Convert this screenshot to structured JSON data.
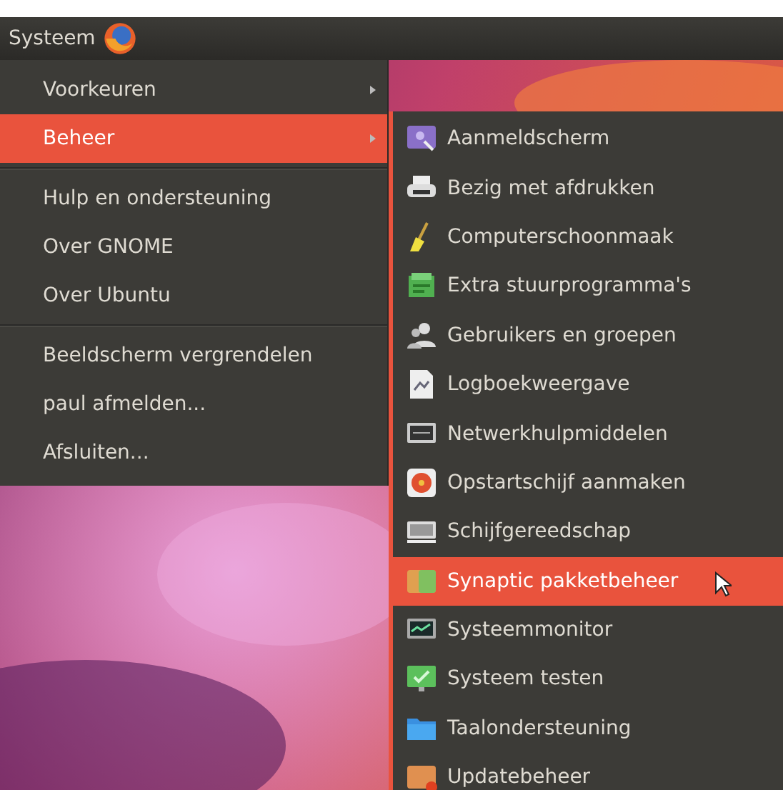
{
  "panel": {
    "menu_label": "Systeem"
  },
  "menu": {
    "sections": [
      {
        "items": [
          {
            "label": "Voorkeuren",
            "selected": false,
            "submenu": true
          },
          {
            "label": "Beheer",
            "selected": true,
            "submenu": true
          }
        ]
      },
      {
        "items": [
          {
            "label": "Hulp en ondersteuning",
            "selected": false,
            "submenu": false
          },
          {
            "label": "Over GNOME",
            "selected": false,
            "submenu": false
          },
          {
            "label": "Over Ubuntu",
            "selected": false,
            "submenu": false
          }
        ]
      },
      {
        "items": [
          {
            "label": "Beeldscherm vergrendelen",
            "selected": false,
            "submenu": false
          },
          {
            "label": "paul afmelden...",
            "selected": false,
            "submenu": false
          },
          {
            "label": "Afsluiten...",
            "selected": false,
            "submenu": false
          }
        ]
      }
    ]
  },
  "submenu": {
    "items": [
      {
        "label": "Aanmeldscherm",
        "selected": false
      },
      {
        "label": "Bezig met afdrukken",
        "selected": false
      },
      {
        "label": "Computerschoonmaak",
        "selected": false
      },
      {
        "label": "Extra stuurprogramma's",
        "selected": false
      },
      {
        "label": "Gebruikers en groepen",
        "selected": false
      },
      {
        "label": "Logboekweergave",
        "selected": false
      },
      {
        "label": "Netwerkhulpmiddelen",
        "selected": false
      },
      {
        "label": "Opstartschijf aanmaken",
        "selected": false
      },
      {
        "label": "Schijfgereedschap",
        "selected": false
      },
      {
        "label": "Synaptic pakketbeheer",
        "selected": true
      },
      {
        "label": "Systeemmonitor",
        "selected": false
      },
      {
        "label": "Systeem testen",
        "selected": false
      },
      {
        "label": "Taalondersteuning",
        "selected": false
      },
      {
        "label": "Updatebeheer",
        "selected": false
      }
    ]
  }
}
